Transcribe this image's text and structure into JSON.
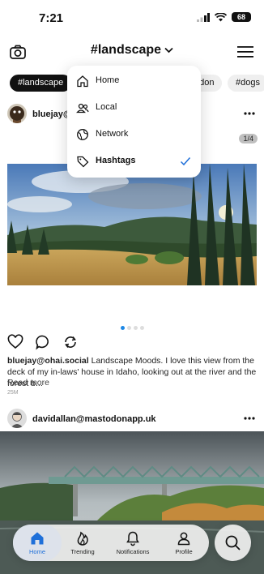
{
  "status_bar": {
    "time": "7:21",
    "battery": "68"
  },
  "header": {
    "title": "#landscape"
  },
  "tags": [
    "#landscape",
    "ndon",
    "#dogs"
  ],
  "dropdown": {
    "items": [
      {
        "label": "Home",
        "icon": "house-icon"
      },
      {
        "label": "Local",
        "icon": "people-icon"
      },
      {
        "label": "Network",
        "icon": "globe-icon"
      },
      {
        "label": "Hashtags",
        "icon": "tag-icon",
        "selected": true
      }
    ]
  },
  "post1": {
    "handle": "bluejay@",
    "handle_full": "bluejay@ohai.social",
    "counter": "1/4",
    "body": "Landscape Moods. I love this view from the deck of my in-laws' house in Idaho, looking out at the river and the forest b...",
    "read_more": "Read more",
    "time": "25M"
  },
  "post2": {
    "handle": "davidallan@mastodonapp.uk"
  },
  "tabbar": {
    "tabs": [
      {
        "label": "Home",
        "active": true
      },
      {
        "label": "Trending"
      },
      {
        "label": "Notifications"
      },
      {
        "label": "Profile"
      }
    ]
  },
  "colors": {
    "accent": "#1e6fd9",
    "chip_active_bg": "#111111"
  }
}
